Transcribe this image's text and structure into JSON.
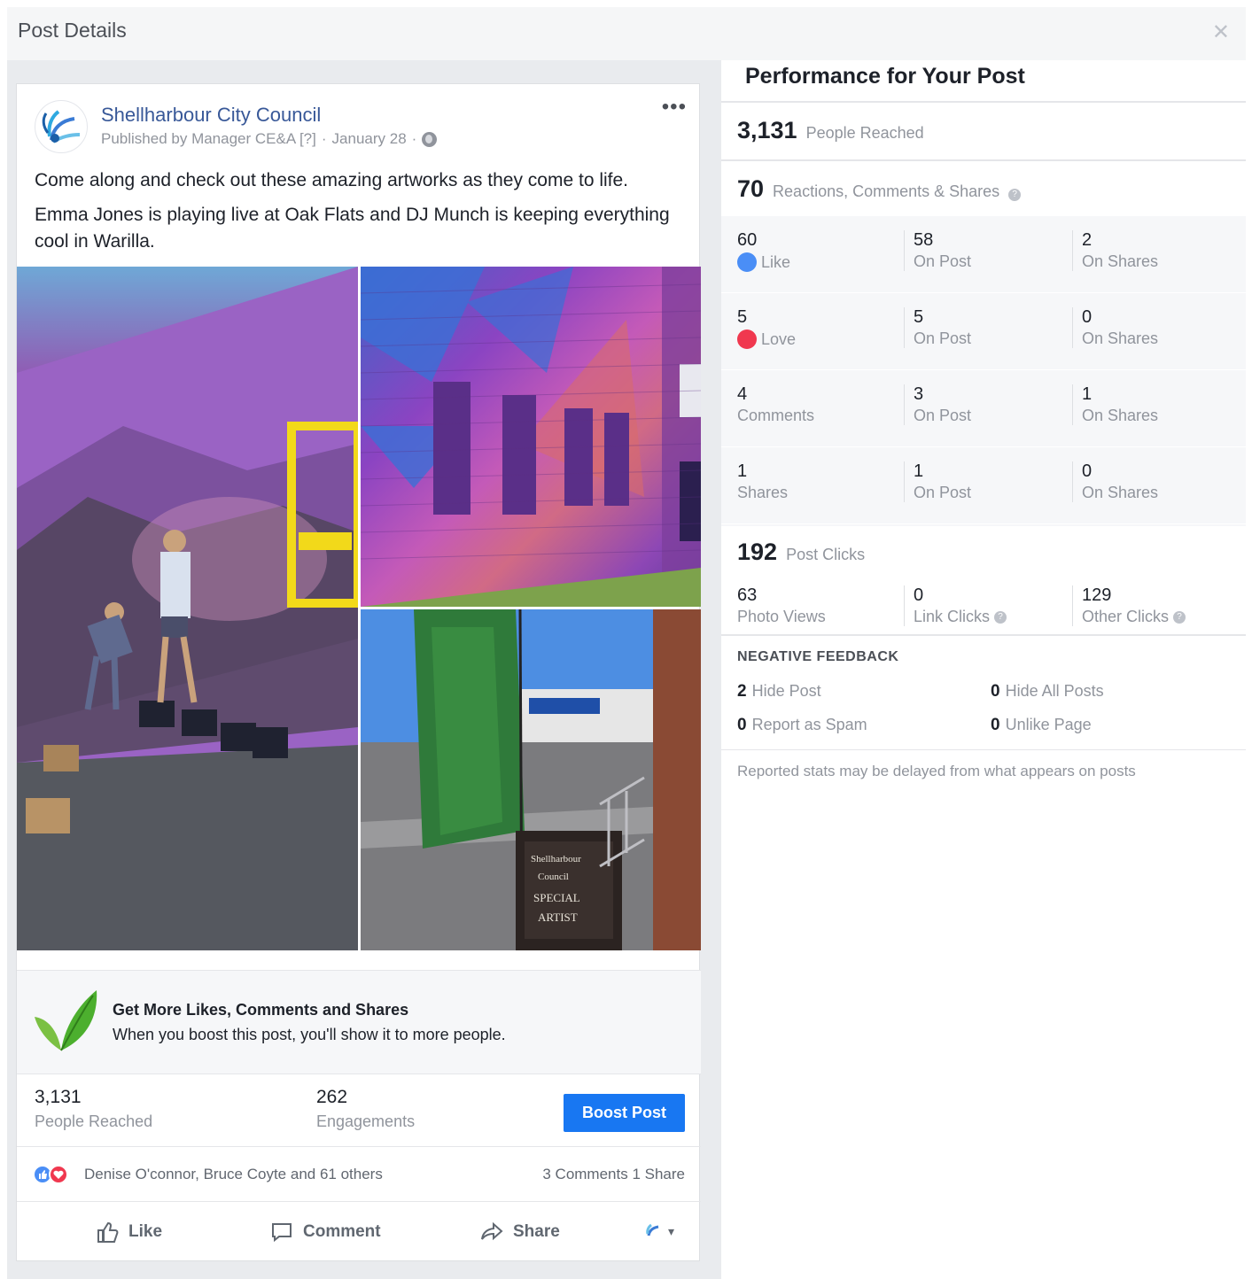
{
  "header": {
    "title": "Post Details",
    "close_icon": "close-icon"
  },
  "post": {
    "page_name": "Shellharbour City Council",
    "published_by": "Published by Manager CE&A [?]",
    "date": "January 28",
    "text_paragraphs": [
      "Come along and check out these amazing artworks as they come to life.",
      "Emma Jones is playing live at Oak Flats and DJ Munch is keeping everything cool in Warilla."
    ],
    "photos": [
      "mural-painting-photo",
      "brick-wall-mural-photo",
      "street-banner-photo"
    ],
    "promo": {
      "title": "Get More Likes, Comments and Shares",
      "subtitle": "When you boost this post, you'll show it to more people."
    },
    "stats": {
      "reached_value": "3,131",
      "reached_label": "People Reached",
      "engagements_value": "262",
      "engagements_label": "Engagements"
    },
    "boost_button": "Boost Post",
    "reactors": "Denise O'connor, Bruce Coyte and 61 others",
    "comments_shares": "3 Comments  1 Share",
    "actions": {
      "like": "Like",
      "comment": "Comment",
      "share": "Share"
    }
  },
  "performance": {
    "title": "Performance for Your Post",
    "reached": {
      "value": "3,131",
      "label": "People Reached"
    },
    "engagement": {
      "value": "70",
      "label": "Reactions, Comments & Shares"
    },
    "reaction_rows": [
      {
        "total": "60",
        "label": "Like",
        "on_post": "58",
        "on_post_label": "On Post",
        "on_shares": "2",
        "on_shares_label": "On Shares"
      },
      {
        "total": "5",
        "label": "Love",
        "on_post": "5",
        "on_post_label": "On Post",
        "on_shares": "0",
        "on_shares_label": "On Shares"
      },
      {
        "total": "4",
        "label": "Comments",
        "on_post": "3",
        "on_post_label": "On Post",
        "on_shares": "1",
        "on_shares_label": "On Shares"
      },
      {
        "total": "1",
        "label": "Shares",
        "on_post": "1",
        "on_post_label": "On Post",
        "on_shares": "0",
        "on_shares_label": "On Shares"
      }
    ],
    "post_clicks": {
      "value": "192",
      "label": "Post Clicks"
    },
    "click_breakdown": [
      {
        "value": "63",
        "label": "Photo Views"
      },
      {
        "value": "0",
        "label": "Link Clicks"
      },
      {
        "value": "129",
        "label": "Other Clicks"
      }
    ],
    "negative_feedback": {
      "title": "NEGATIVE FEEDBACK",
      "items": [
        {
          "value": "2",
          "label": "Hide Post"
        },
        {
          "value": "0",
          "label": "Hide All Posts"
        },
        {
          "value": "0",
          "label": "Report as Spam"
        },
        {
          "value": "0",
          "label": "Unlike Page"
        }
      ]
    },
    "footnote": "Reported stats may be delayed from what appears on posts"
  },
  "colors": {
    "link_blue": "#385898",
    "boost_blue": "#1877f2",
    "like_blue": "#4a8ef6",
    "love_red": "#f0384f",
    "muted_gray": "#90949c"
  }
}
